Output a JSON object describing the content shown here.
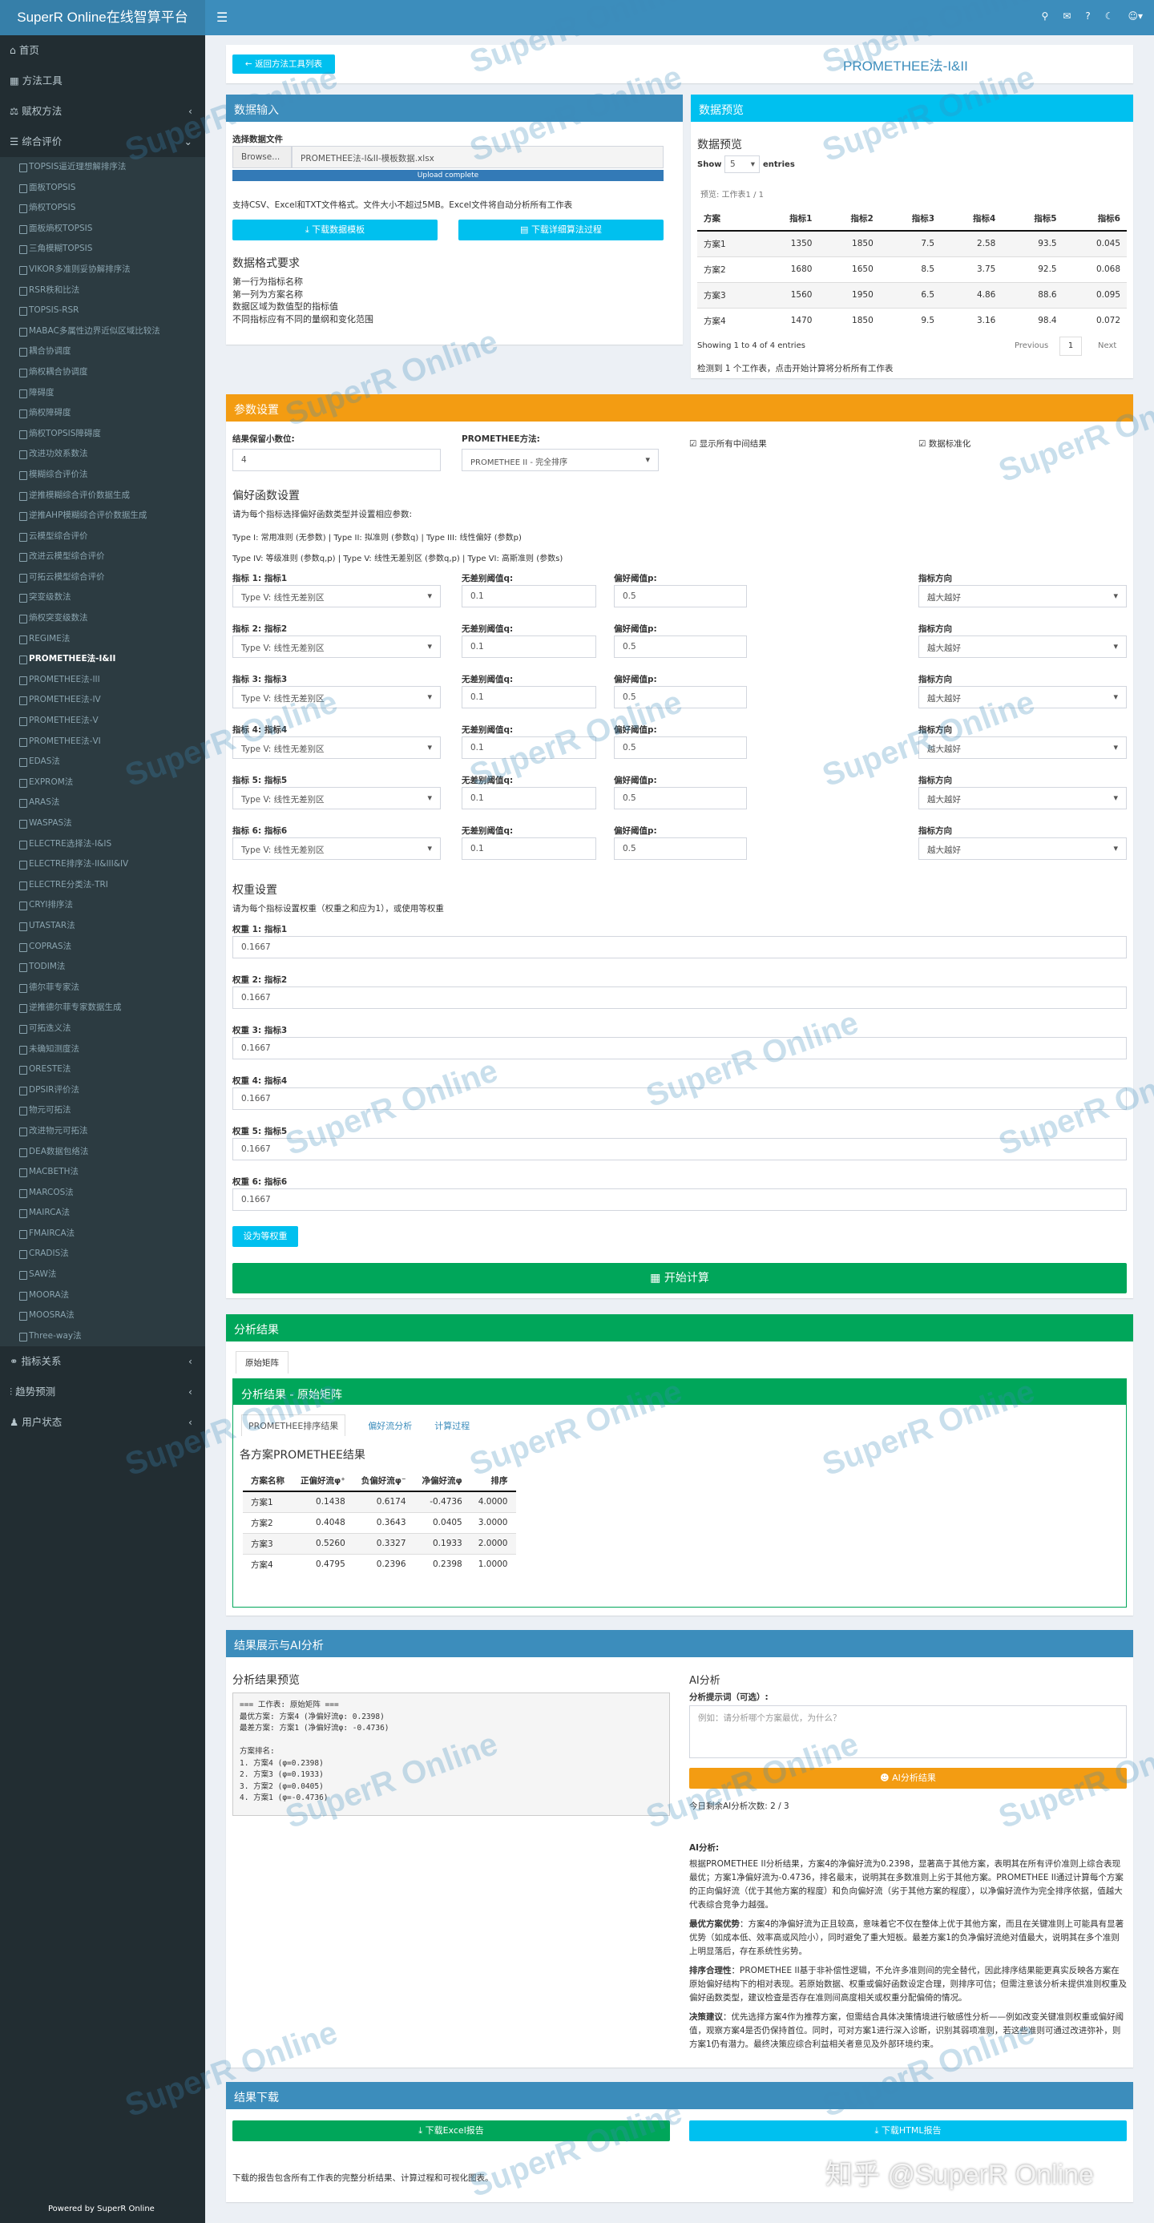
{
  "app": {
    "title": "SuperR Online在线智算平台",
    "footer": "Powered by SuperR Online"
  },
  "sidebar": {
    "top": [
      {
        "label": "首页",
        "icon": "home-icon"
      },
      {
        "label": "方法工具",
        "icon": "table-icon"
      },
      {
        "label": "赋权方法",
        "icon": "scale-icon"
      },
      {
        "label": "综合评价",
        "icon": "list-icon"
      }
    ],
    "sub": [
      "TOPSIS逼近理想解排序法",
      "面板TOPSIS",
      "熵权TOPSIS",
      "面板熵权TOPSIS",
      "三角模糊TOPSIS",
      "VIKOR多准则妥协解排序法",
      "RSR秩和比法",
      "TOPSIS-RSR",
      "MABAC多属性边界近似区域比较法",
      "耦合协调度",
      "熵权耦合协调度",
      "障碍度",
      "熵权障碍度",
      "熵权TOPSIS障碍度",
      "改进功效系数法",
      "模糊综合评价法",
      "逆推模糊综合评价数据生成",
      "逆推AHP模糊综合评价数据生成",
      "云模型综合评价",
      "改进云模型综合评价",
      "可拓云模型综合评价",
      "突变级数法",
      "熵权突变级数法",
      "REGIME法",
      "PROMETHEE法-I&II",
      "PROMETHEE法-III",
      "PROMETHEE法-IV",
      "PROMETHEE法-V",
      "PROMETHEE法-VI",
      "EDAS法",
      "EXPROM法",
      "ARAS法",
      "WASPAS法",
      "ELECTRE选择法-I&IS",
      "ELECTRE排序法-II&III&IV",
      "ELECTRE分类法-TRI",
      "CRYI排序法",
      "UTASTAR法",
      "COPRAS法",
      "TODIM法",
      "德尔菲专家法",
      "逆推德尔菲专家数据生成",
      "可拓迭义法",
      "未确知测度法",
      "ORESTE法",
      "DPSIR评价法",
      "物元可拓法",
      "改进物元可拓法",
      "DEA数据包络法",
      "MACBETH法",
      "MARCOS法",
      "MAIRCA法",
      "FMAIRCA法",
      "CRADIS法",
      "SAW法",
      "MOORA法",
      "MOOSRA法",
      "Three-way法"
    ],
    "bottom": [
      {
        "label": "指标关系",
        "icon": "link-icon"
      },
      {
        "label": "趋势预测",
        "icon": "chart-icon"
      },
      {
        "label": "用户状态",
        "icon": "user-icon"
      }
    ]
  },
  "header": {
    "back": "返回方法工具列表",
    "title": "PROMETHEE法-I&II"
  },
  "input": {
    "title": "数据输入",
    "file_label": "选择数据文件",
    "browse": "Browse...",
    "file_name": "PROMETHEE法-I&II-模板数据.xlsx",
    "progress": "Upload complete",
    "hint": "支持CSV、Excel和TXT文件格式。文件大小不超过5MB。Excel文件将自动分析所有工作表",
    "dl_template": "下载数据模板",
    "dl_process": "下载详细算法过程",
    "req_title": "数据格式要求",
    "req": [
      "第一行为指标名称",
      "第一列为方案名称",
      "数据区域为数值型的指标值",
      "不同指标应有不同的量纲和变化范围"
    ]
  },
  "preview": {
    "title": "数据预览",
    "subtitle": "数据预览",
    "show": "Show",
    "entries_val": "5",
    "entries": "entries",
    "sheet": "预览: 工作表1 / 1",
    "headers": [
      "方案",
      "指标1",
      "指标2",
      "指标3",
      "指标4",
      "指标5",
      "指标6"
    ],
    "rows": [
      [
        "方案1",
        "1350",
        "1850",
        "7.5",
        "2.58",
        "93.5",
        "0.045"
      ],
      [
        "方案2",
        "1680",
        "1650",
        "8.5",
        "3.75",
        "92.5",
        "0.068"
      ],
      [
        "方案3",
        "1560",
        "1950",
        "6.5",
        "4.86",
        "88.6",
        "0.095"
      ],
      [
        "方案4",
        "1470",
        "1850",
        "9.5",
        "3.16",
        "98.4",
        "0.072"
      ]
    ],
    "showing": "Showing 1 to 4 of 4 entries",
    "prev": "Previous",
    "page": "1",
    "next": "Next",
    "detect": "检测到 1 个工作表，点击开始计算将分析所有工作表"
  },
  "params": {
    "title": "参数设置",
    "decimals_label": "结果保留小数位:",
    "decimals": "4",
    "method_label": "PROMETHEE方法:",
    "method": "PROMETHEE II - 完全排序",
    "show_mid": "显示所有中间结果",
    "normalize": "数据标准化",
    "pref_title": "偏好函数设置",
    "pref_desc": "请为每个指标选择偏好函数类型并设置相应参数:",
    "types1": "Type I: 常用准则 (无参数) | Type II: 拟准则 (参数q) | Type III: 线性偏好 (参数p)",
    "types2": "Type IV: 等级准则 (参数q,p) | Type V: 线性无差别区 (参数q,p) | Type VI: 高斯准则 (参数s)",
    "criteria": [
      {
        "name": "指标 1: 指标1",
        "ftype": "Type V: 线性无差别区",
        "q_label": "无差别阈值q:",
        "q": "0.1",
        "p_label": "偏好阈值p:",
        "p": "0.5",
        "dir_label": "指标方向",
        "dir": "越大越好"
      },
      {
        "name": "指标 2: 指标2",
        "ftype": "Type V: 线性无差别区",
        "q_label": "无差别阈值q:",
        "q": "0.1",
        "p_label": "偏好阈值p:",
        "p": "0.5",
        "dir_label": "指标方向",
        "dir": "越大越好"
      },
      {
        "name": "指标 3: 指标3",
        "ftype": "Type V: 线性无差别区",
        "q_label": "无差别阈值q:",
        "q": "0.1",
        "p_label": "偏好阈值p:",
        "p": "0.5",
        "dir_label": "指标方向",
        "dir": "越大越好"
      },
      {
        "name": "指标 4: 指标4",
        "ftype": "Type V: 线性无差别区",
        "q_label": "无差别阈值q:",
        "q": "0.1",
        "p_label": "偏好阈值p:",
        "p": "0.5",
        "dir_label": "指标方向",
        "dir": "越大越好"
      },
      {
        "name": "指标 5: 指标5",
        "ftype": "Type V: 线性无差别区",
        "q_label": "无差别阈值q:",
        "q": "0.1",
        "p_label": "偏好阈值p:",
        "p": "0.5",
        "dir_label": "指标方向",
        "dir": "越大越好"
      },
      {
        "name": "指标 6: 指标6",
        "ftype": "Type V: 线性无差别区",
        "q_label": "无差别阈值q:",
        "q": "0.1",
        "p_label": "偏好阈值p:",
        "p": "0.5",
        "dir_label": "指标方向",
        "dir": "越大越好"
      }
    ],
    "weight_title": "权重设置",
    "weight_desc": "请为每个指标设置权重（权重之和应为1），或使用等权重",
    "weights": [
      {
        "label": "权重 1: 指标1",
        "value": "0.1667"
      },
      {
        "label": "权重 2: 指标2",
        "value": "0.1667"
      },
      {
        "label": "权重 3: 指标3",
        "value": "0.1667"
      },
      {
        "label": "权重 4: 指标4",
        "value": "0.1667"
      },
      {
        "label": "权重 5: 指标5",
        "value": "0.1667"
      },
      {
        "label": "权重 6: 指标6",
        "value": "0.1667"
      }
    ],
    "equal_btn": "设为等权重",
    "start_btn": "开始计算"
  },
  "results": {
    "title": "分析结果",
    "tab": "原始矩阵",
    "inner_title": "分析结果 - 原始矩阵",
    "tabs": [
      "PROMETHEE排序结果",
      "偏好流分析",
      "计算过程"
    ],
    "table_title": "各方案PROMETHEE结果",
    "headers": [
      "方案名称",
      "正偏好流φ⁺",
      "负偏好流φ⁻",
      "净偏好流φ",
      "排序"
    ],
    "rows": [
      [
        "方案1",
        "0.1438",
        "0.6174",
        "-0.4736",
        "4.0000"
      ],
      [
        "方案2",
        "0.4048",
        "0.3643",
        "0.0405",
        "3.0000"
      ],
      [
        "方案3",
        "0.5260",
        "0.3327",
        "0.1933",
        "2.0000"
      ],
      [
        "方案4",
        "0.4795",
        "0.2396",
        "0.2398",
        "1.0000"
      ]
    ]
  },
  "ai": {
    "title": "结果展示与AI分析",
    "preview_title": "分析结果预览",
    "preview_lines": [
      "=== 工作表: 原始矩阵 ===",
      "最优方案: 方案4 (净偏好流φ: 0.2398)",
      "最差方案: 方案1 (净偏好流φ: -0.4736)",
      "",
      "方案排名:",
      "1. 方案4 (φ=0.2398)",
      "2. 方案3 (φ=0.1933)",
      "3. 方案2 (φ=0.0405)",
      "4. 方案1 (φ=-0.4736)"
    ],
    "ai_title": "AI分析",
    "prompt_label": "分析提示词（可选）:",
    "prompt_ph": "例如：请分析哪个方案最优，为什么？",
    "ai_btn": "AI分析结果",
    "remaining": "今日剩余AI分析次数: 2 / 3",
    "result_head": "AI分析:",
    "paras": [
      {
        "b": "",
        "t": "根据PROMETHEE II分析结果，方案4的净偏好流为0.2398，显著高于其他方案，表明其在所有评价准则上综合表现最优；方案1净偏好流为-0.4736，排名最末，说明其在多数准则上劣于其他方案。PROMETHEE II通过计算每个方案的正向偏好流（优于其他方案的程度）和负向偏好流（劣于其他方案的程度），以净偏好流作为完全排序依据，值越大代表综合竞争力越强。"
      },
      {
        "b": "最优方案优势",
        "t": "：方案4的净偏好流为正且较高，意味着它不仅在整体上优于其他方案，而且在关键准则上可能具有显著优势（如成本低、效率高或风险小），同时避免了重大短板。最差方案1的负净偏好流绝对值最大，说明其在多个准则上明显落后，存在系统性劣势。"
      },
      {
        "b": "排序合理性",
        "t": "：PROMETHEE II基于非补偿性逻辑，不允许多准则间的完全替代，因此排序结果能更真实反映各方案在原始偏好结构下的相对表现。若原始数据、权重或偏好函数设定合理，则排序可信；但需注意该分析未提供准则权重及偏好函数类型，建议检查是否存在准则间高度相关或权重分配偏倚的情况。"
      },
      {
        "b": "决策建议",
        "t": "：优先选择方案4作为推荐方案，但需结合具体决策情境进行敏感性分析——例如改变关键准则权重或偏好阈值，观察方案4是否仍保持首位。同时，可对方案1进行深入诊断，识别其弱项准则，若这些准则可通过改进弥补，则方案1仍有潜力。最终决策应综合利益相关者意见及外部环境约束。"
      }
    ]
  },
  "download": {
    "title": "结果下载",
    "excel": "下载Excel报告",
    "html": "下载HTML报告",
    "note": "下载的报告包含所有工作表的完整分析结果、计算过程和可视化图表。"
  },
  "watermark": "SuperR Online",
  "zhihu": "知乎 @SuperR Online"
}
